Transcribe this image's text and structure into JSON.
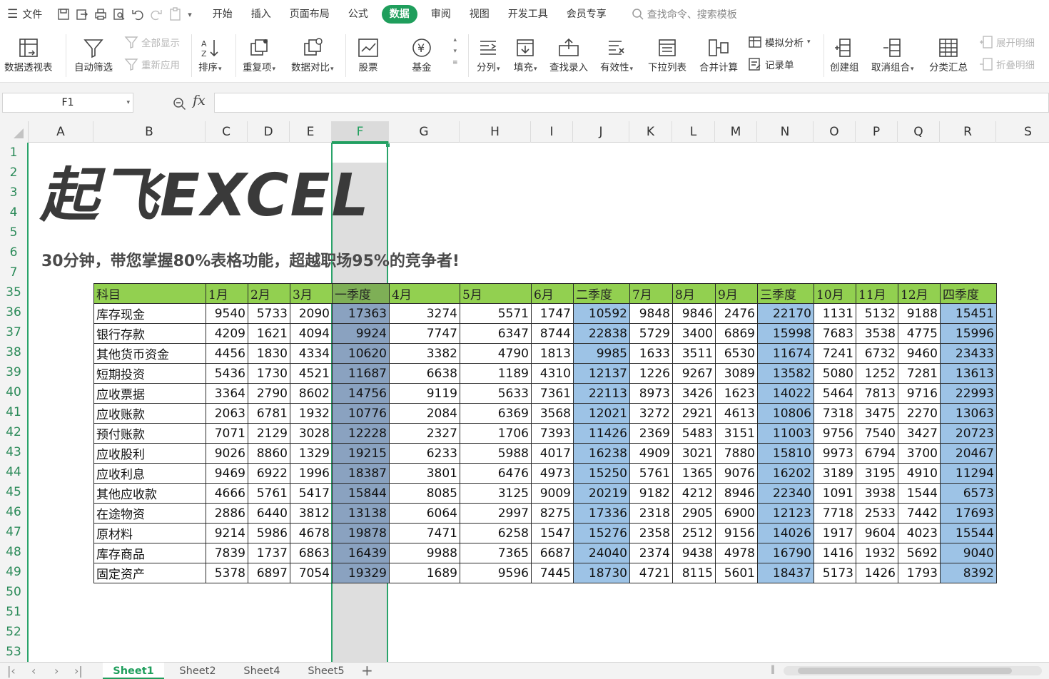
{
  "menubar": {
    "file_label": "文件",
    "tabs": [
      "开始",
      "插入",
      "页面布局",
      "公式",
      "数据",
      "审阅",
      "视图",
      "开发工具",
      "会员专享"
    ],
    "active_tab": "数据",
    "search_placeholder": "查找命令、搜索模板",
    "accent_color": "#1f9e5c"
  },
  "ribbon": {
    "pivot": "数据透视表",
    "autofilter": "自动筛选",
    "show_all": "全部显示",
    "reapply": "重新应用",
    "sort": "排序",
    "duplicates": "重复项",
    "compare": "数据对比",
    "stocks": "股票",
    "funds": "基金",
    "split": "分列",
    "fill": "填充",
    "lookup": "查找录入",
    "validation": "有效性",
    "dropdown": "下拉列表",
    "consolidate": "合并计算",
    "whatif": "模拟分析",
    "form": "记录单",
    "group": "创建组",
    "ungroup": "取消组合",
    "subtotal": "分类汇总",
    "expand": "展开明细",
    "collapse": "折叠明细"
  },
  "formula_bar": {
    "name_box": "F1",
    "fx_label": "fx",
    "formula": ""
  },
  "columns": [
    "A",
    "B",
    "C",
    "D",
    "E",
    "F",
    "G",
    "H",
    "I",
    "J",
    "K",
    "L",
    "M",
    "N",
    "O",
    "P",
    "Q",
    "R",
    "S"
  ],
  "selected_column": "F",
  "rows": [
    "1",
    "2",
    "3",
    "4",
    "5",
    "6",
    "7",
    "35",
    "36",
    "37",
    "38",
    "39",
    "40",
    "41",
    "42",
    "43",
    "44",
    "45",
    "46",
    "47",
    "48",
    "49",
    "50",
    "51",
    "52",
    "53"
  ],
  "sheet": {
    "title": "起飞EXCEL",
    "subtitle": "30分钟，带您掌握80%表格功能，超越职场95%的竞争者!"
  },
  "table": {
    "headers": [
      "科目",
      "1月",
      "2月",
      "3月",
      "一季度",
      "4月",
      "5月",
      "6月",
      "二季度",
      "7月",
      "8月",
      "9月",
      "三季度",
      "10月",
      "11月",
      "12月",
      "四季度"
    ],
    "rows": [
      [
        "库存现金",
        9540,
        5733,
        2090,
        17363,
        3274,
        5571,
        1747,
        10592,
        9848,
        9846,
        2476,
        22170,
        1131,
        5132,
        9188,
        15451
      ],
      [
        "银行存款",
        4209,
        1621,
        4094,
        9924,
        7747,
        6347,
        8744,
        22838,
        5729,
        3400,
        6869,
        15998,
        7683,
        3538,
        4775,
        15996
      ],
      [
        "其他货币资金",
        4456,
        1830,
        4334,
        10620,
        3382,
        4790,
        1813,
        9985,
        1633,
        3511,
        6530,
        11674,
        7241,
        6732,
        9460,
        23433
      ],
      [
        "短期投资",
        5436,
        1730,
        4521,
        11687,
        6638,
        1189,
        4310,
        12137,
        1226,
        9267,
        3089,
        13582,
        5080,
        1252,
        7281,
        13613
      ],
      [
        "应收票据",
        3364,
        2790,
        8602,
        14756,
        9119,
        5633,
        7361,
        22113,
        8973,
        3426,
        1623,
        14022,
        5464,
        7813,
        9716,
        22993
      ],
      [
        "应收账款",
        2063,
        6781,
        1932,
        10776,
        2084,
        6369,
        3568,
        12021,
        3272,
        2921,
        4613,
        10806,
        7318,
        3475,
        2270,
        13063
      ],
      [
        "预付账款",
        7071,
        2129,
        3028,
        12228,
        2327,
        1706,
        7393,
        11426,
        2369,
        5483,
        3151,
        11003,
        9756,
        7540,
        3427,
        20723
      ],
      [
        "应收股利",
        9026,
        8860,
        1329,
        19215,
        6233,
        5988,
        4017,
        16238,
        4909,
        3021,
        7880,
        15810,
        9973,
        6794,
        3700,
        20467
      ],
      [
        "应收利息",
        9469,
        6922,
        1996,
        18387,
        3801,
        6476,
        4973,
        15250,
        5761,
        1365,
        9076,
        16202,
        3189,
        3195,
        4910,
        11294
      ],
      [
        "其他应收款",
        4666,
        5761,
        5417,
        15844,
        8085,
        3125,
        9009,
        20219,
        9182,
        4212,
        8946,
        22340,
        1091,
        3938,
        1544,
        6573
      ],
      [
        "在途物资",
        2886,
        6440,
        3812,
        13138,
        6064,
        2997,
        8275,
        17336,
        2318,
        2905,
        6900,
        12123,
        7718,
        2533,
        7442,
        17693
      ],
      [
        "原材料",
        9214,
        5986,
        4678,
        19878,
        7471,
        6258,
        1547,
        15276,
        2358,
        2512,
        9156,
        14026,
        1917,
        9604,
        4023,
        15544
      ],
      [
        "库存商品",
        7839,
        1737,
        6863,
        16439,
        9988,
        7365,
        6687,
        24040,
        2374,
        9438,
        4978,
        16790,
        1416,
        1932,
        5692,
        9040
      ],
      [
        "固定资产",
        5378,
        6897,
        7054,
        19329,
        1689,
        9596,
        7445,
        18730,
        4721,
        8115,
        5601,
        18437,
        5173,
        1426,
        1793,
        8392
      ]
    ],
    "header_color": "#92d050",
    "quarter_color": "#9dc3e6"
  },
  "sheet_tabs": [
    "Sheet1",
    "Sheet2",
    "Sheet4",
    "Sheet5"
  ],
  "active_sheet": "Sheet1"
}
